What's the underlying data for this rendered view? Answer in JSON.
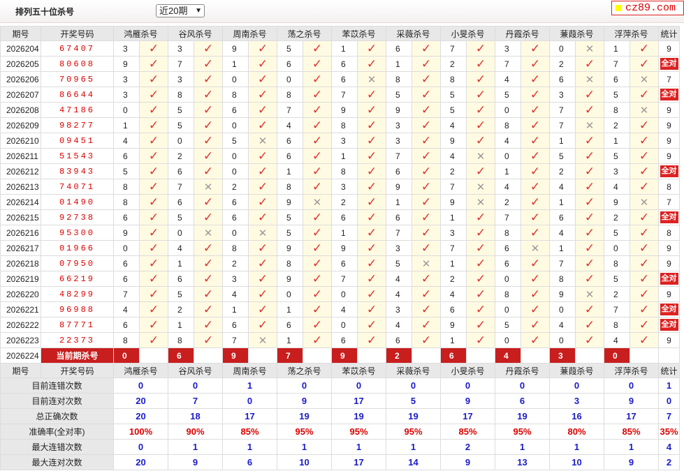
{
  "header": {
    "title": "排列五十位杀号",
    "period_select": "近20期",
    "logo_text": "cz89.com"
  },
  "columns": {
    "period": "期号",
    "draw": "开奖号码",
    "killers": [
      "鸿雁杀号",
      "谷风杀号",
      "周南杀号",
      "荡之杀号",
      "苯苡杀号",
      "采薇杀号",
      "小旻杀号",
      "丹霞杀号",
      "蒹葭杀号",
      "浮萍杀号"
    ],
    "stats": "统计"
  },
  "rows": [
    {
      "period": "2026204",
      "draw": "67407",
      "kills": [
        [
          3,
          1
        ],
        [
          3,
          1
        ],
        [
          9,
          1
        ],
        [
          5,
          1
        ],
        [
          1,
          1
        ],
        [
          6,
          1
        ],
        [
          7,
          1
        ],
        [
          3,
          1
        ],
        [
          0,
          0
        ],
        [
          1,
          1
        ]
      ],
      "stat": "9"
    },
    {
      "period": "2026205",
      "draw": "80608",
      "kills": [
        [
          9,
          1
        ],
        [
          7,
          1
        ],
        [
          1,
          1
        ],
        [
          6,
          1
        ],
        [
          6,
          1
        ],
        [
          1,
          1
        ],
        [
          2,
          1
        ],
        [
          7,
          1
        ],
        [
          2,
          1
        ],
        [
          7,
          1
        ]
      ],
      "stat": "全对"
    },
    {
      "period": "2026206",
      "draw": "70965",
      "kills": [
        [
          3,
          1
        ],
        [
          3,
          1
        ],
        [
          0,
          1
        ],
        [
          0,
          1
        ],
        [
          6,
          0
        ],
        [
          8,
          1
        ],
        [
          8,
          1
        ],
        [
          4,
          1
        ],
        [
          6,
          0
        ],
        [
          6,
          0
        ]
      ],
      "stat": "7"
    },
    {
      "period": "2026207",
      "draw": "86644",
      "kills": [
        [
          3,
          1
        ],
        [
          8,
          1
        ],
        [
          8,
          1
        ],
        [
          8,
          1
        ],
        [
          7,
          1
        ],
        [
          5,
          1
        ],
        [
          5,
          1
        ],
        [
          5,
          1
        ],
        [
          3,
          1
        ],
        [
          5,
          1
        ]
      ],
      "stat": "全对"
    },
    {
      "period": "2026208",
      "draw": "47186",
      "kills": [
        [
          0,
          1
        ],
        [
          5,
          1
        ],
        [
          6,
          1
        ],
        [
          7,
          1
        ],
        [
          9,
          1
        ],
        [
          9,
          1
        ],
        [
          5,
          1
        ],
        [
          0,
          1
        ],
        [
          7,
          1
        ],
        [
          8,
          0
        ]
      ],
      "stat": "9"
    },
    {
      "period": "2026209",
      "draw": "98277",
      "kills": [
        [
          1,
          1
        ],
        [
          5,
          1
        ],
        [
          0,
          1
        ],
        [
          4,
          1
        ],
        [
          8,
          1
        ],
        [
          3,
          1
        ],
        [
          4,
          1
        ],
        [
          8,
          1
        ],
        [
          7,
          0
        ],
        [
          2,
          1
        ]
      ],
      "stat": "9"
    },
    {
      "period": "2026210",
      "draw": "09451",
      "kills": [
        [
          4,
          1
        ],
        [
          0,
          1
        ],
        [
          5,
          0
        ],
        [
          6,
          1
        ],
        [
          3,
          1
        ],
        [
          3,
          1
        ],
        [
          9,
          1
        ],
        [
          4,
          1
        ],
        [
          1,
          1
        ],
        [
          1,
          1
        ]
      ],
      "stat": "9"
    },
    {
      "period": "2026211",
      "draw": "51543",
      "kills": [
        [
          6,
          1
        ],
        [
          2,
          1
        ],
        [
          0,
          1
        ],
        [
          6,
          1
        ],
        [
          1,
          1
        ],
        [
          7,
          1
        ],
        [
          4,
          0
        ],
        [
          0,
          1
        ],
        [
          5,
          1
        ],
        [
          5,
          1
        ]
      ],
      "stat": "9"
    },
    {
      "period": "2026212",
      "draw": "83943",
      "kills": [
        [
          5,
          1
        ],
        [
          6,
          1
        ],
        [
          0,
          1
        ],
        [
          1,
          1
        ],
        [
          8,
          1
        ],
        [
          6,
          1
        ],
        [
          2,
          1
        ],
        [
          1,
          1
        ],
        [
          2,
          1
        ],
        [
          3,
          1
        ]
      ],
      "stat": "全对"
    },
    {
      "period": "2026213",
      "draw": "74071",
      "kills": [
        [
          8,
          1
        ],
        [
          7,
          0
        ],
        [
          2,
          1
        ],
        [
          8,
          1
        ],
        [
          3,
          1
        ],
        [
          9,
          1
        ],
        [
          7,
          0
        ],
        [
          4,
          1
        ],
        [
          4,
          1
        ],
        [
          4,
          1
        ]
      ],
      "stat": "8"
    },
    {
      "period": "2026214",
      "draw": "01490",
      "kills": [
        [
          8,
          1
        ],
        [
          6,
          1
        ],
        [
          6,
          1
        ],
        [
          9,
          0
        ],
        [
          2,
          1
        ],
        [
          1,
          1
        ],
        [
          9,
          0
        ],
        [
          2,
          1
        ],
        [
          1,
          1
        ],
        [
          9,
          0
        ]
      ],
      "stat": "7"
    },
    {
      "period": "2026215",
      "draw": "92738",
      "kills": [
        [
          6,
          1
        ],
        [
          5,
          1
        ],
        [
          6,
          1
        ],
        [
          5,
          1
        ],
        [
          6,
          1
        ],
        [
          6,
          1
        ],
        [
          1,
          1
        ],
        [
          7,
          1
        ],
        [
          6,
          1
        ],
        [
          2,
          1
        ]
      ],
      "stat": "全对"
    },
    {
      "period": "2026216",
      "draw": "95300",
      "kills": [
        [
          9,
          1
        ],
        [
          0,
          0
        ],
        [
          0,
          0
        ],
        [
          5,
          1
        ],
        [
          1,
          1
        ],
        [
          7,
          1
        ],
        [
          3,
          1
        ],
        [
          8,
          1
        ],
        [
          4,
          1
        ],
        [
          5,
          1
        ]
      ],
      "stat": "8"
    },
    {
      "period": "2026217",
      "draw": "01966",
      "kills": [
        [
          0,
          1
        ],
        [
          4,
          1
        ],
        [
          8,
          1
        ],
        [
          9,
          1
        ],
        [
          9,
          1
        ],
        [
          3,
          1
        ],
        [
          7,
          1
        ],
        [
          6,
          0
        ],
        [
          1,
          1
        ],
        [
          0,
          1
        ]
      ],
      "stat": "9"
    },
    {
      "period": "2026218",
      "draw": "07950",
      "kills": [
        [
          6,
          1
        ],
        [
          1,
          1
        ],
        [
          2,
          1
        ],
        [
          8,
          1
        ],
        [
          6,
          1
        ],
        [
          5,
          0
        ],
        [
          1,
          1
        ],
        [
          6,
          1
        ],
        [
          7,
          1
        ],
        [
          8,
          1
        ]
      ],
      "stat": "9"
    },
    {
      "period": "2026219",
      "draw": "66219",
      "kills": [
        [
          6,
          1
        ],
        [
          6,
          1
        ],
        [
          3,
          1
        ],
        [
          9,
          1
        ],
        [
          7,
          1
        ],
        [
          4,
          1
        ],
        [
          2,
          1
        ],
        [
          0,
          1
        ],
        [
          8,
          1
        ],
        [
          5,
          1
        ]
      ],
      "stat": "全对"
    },
    {
      "period": "2026220",
      "draw": "48299",
      "kills": [
        [
          7,
          1
        ],
        [
          5,
          1
        ],
        [
          4,
          1
        ],
        [
          0,
          1
        ],
        [
          0,
          1
        ],
        [
          4,
          1
        ],
        [
          4,
          1
        ],
        [
          8,
          1
        ],
        [
          9,
          0
        ],
        [
          2,
          1
        ]
      ],
      "stat": "9"
    },
    {
      "period": "2026221",
      "draw": "96988",
      "kills": [
        [
          4,
          1
        ],
        [
          2,
          1
        ],
        [
          1,
          1
        ],
        [
          1,
          1
        ],
        [
          4,
          1
        ],
        [
          3,
          1
        ],
        [
          6,
          1
        ],
        [
          0,
          1
        ],
        [
          0,
          1
        ],
        [
          7,
          1
        ]
      ],
      "stat": "全对"
    },
    {
      "period": "2026222",
      "draw": "87771",
      "kills": [
        [
          6,
          1
        ],
        [
          1,
          1
        ],
        [
          6,
          1
        ],
        [
          6,
          1
        ],
        [
          0,
          1
        ],
        [
          4,
          1
        ],
        [
          9,
          1
        ],
        [
          5,
          1
        ],
        [
          4,
          1
        ],
        [
          8,
          1
        ]
      ],
      "stat": "全对"
    },
    {
      "period": "2026223",
      "draw": "22373",
      "kills": [
        [
          8,
          1
        ],
        [
          8,
          1
        ],
        [
          7,
          0
        ],
        [
          1,
          1
        ],
        [
          6,
          1
        ],
        [
          6,
          1
        ],
        [
          1,
          1
        ],
        [
          0,
          1
        ],
        [
          0,
          1
        ],
        [
          4,
          1
        ]
      ],
      "stat": "9"
    }
  ],
  "current": {
    "period": "2026224",
    "label": "当前期杀号",
    "values": [
      "0",
      "6",
      "9",
      "7",
      "9",
      "2",
      "6",
      "4",
      "3",
      "0"
    ]
  },
  "stats": [
    {
      "label": "目前连错次数",
      "values": [
        "0",
        "0",
        "1",
        "0",
        "0",
        "0",
        "0",
        "0",
        "0",
        "0"
      ],
      "total": "1",
      "pct": false
    },
    {
      "label": "目前连对次数",
      "values": [
        "20",
        "7",
        "0",
        "9",
        "17",
        "5",
        "9",
        "6",
        "3",
        "9"
      ],
      "total": "0",
      "pct": false
    },
    {
      "label": "总正确次数",
      "values": [
        "20",
        "18",
        "17",
        "19",
        "19",
        "19",
        "17",
        "19",
        "16",
        "17"
      ],
      "total": "7",
      "pct": false
    },
    {
      "label": "准确率(全对率)",
      "values": [
        "100%",
        "90%",
        "85%",
        "95%",
        "95%",
        "95%",
        "85%",
        "95%",
        "80%",
        "85%"
      ],
      "total": "35%",
      "pct": true
    },
    {
      "label": "最大连错次数",
      "values": [
        "0",
        "1",
        "1",
        "1",
        "1",
        "1",
        "2",
        "1",
        "1",
        "1"
      ],
      "total": "4",
      "pct": false
    },
    {
      "label": "最大连对次数",
      "values": [
        "20",
        "9",
        "6",
        "10",
        "17",
        "14",
        "9",
        "13",
        "10",
        "9"
      ],
      "total": "2",
      "pct": false
    }
  ]
}
